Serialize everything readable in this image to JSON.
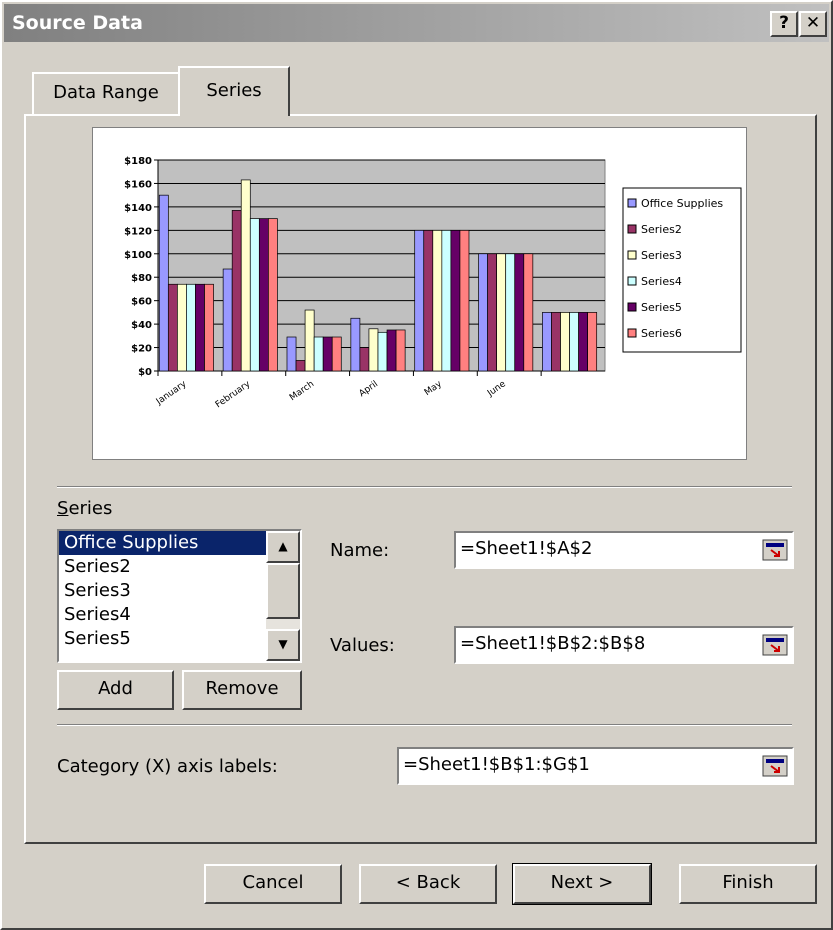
{
  "window": {
    "title": "Source Data",
    "help_label": "?",
    "close_label": "✕"
  },
  "tabs": [
    {
      "label": "Data Range"
    },
    {
      "label": "Series"
    }
  ],
  "series_section": {
    "label": "Series",
    "items": [
      "Office Supplies",
      "Series2",
      "Series3",
      "Series4",
      "Series5"
    ],
    "selected": "Office Supplies"
  },
  "fields": {
    "name": {
      "label": "Name:",
      "value": "=Sheet1!$A$2"
    },
    "values": {
      "label": "Values:",
      "value": "=Sheet1!$B$2:$B$8"
    },
    "category": {
      "label": "Category (X) axis labels:",
      "value": "=Sheet1!$B$1:$G$1"
    }
  },
  "list_buttons": {
    "add": "Add",
    "remove": "Remove"
  },
  "footer_buttons": {
    "cancel": "Cancel",
    "back": "< Back",
    "next": "Next >",
    "finish": "Finish"
  },
  "chart_data": {
    "type": "bar",
    "categories": [
      "January",
      "February",
      "March",
      "April",
      "May",
      "June",
      ""
    ],
    "ylim": [
      0,
      180
    ],
    "yticks": [
      "$0",
      "$20",
      "$40",
      "$60",
      "$80",
      "$100",
      "$120",
      "$140",
      "$160",
      "$180"
    ],
    "grid": true,
    "legend_position": "right",
    "series": [
      {
        "name": "Office Supplies",
        "color": "#9999ff",
        "values": [
          150,
          87,
          29,
          45,
          120,
          100,
          50
        ]
      },
      {
        "name": "Series2",
        "color": "#993366",
        "values": [
          74,
          137,
          9,
          20,
          120,
          100,
          50
        ]
      },
      {
        "name": "Series3",
        "color": "#ffffcc",
        "values": [
          74,
          163,
          52,
          36,
          120,
          100,
          50
        ]
      },
      {
        "name": "Series4",
        "color": "#ccffff",
        "values": [
          74,
          130,
          29,
          33,
          120,
          100,
          50
        ]
      },
      {
        "name": "Series5",
        "color": "#660066",
        "values": [
          74,
          130,
          29,
          35,
          120,
          100,
          50
        ]
      },
      {
        "name": "Series6",
        "color": "#ff8080",
        "values": [
          74,
          130,
          29,
          35,
          120,
          100,
          50
        ]
      }
    ]
  }
}
